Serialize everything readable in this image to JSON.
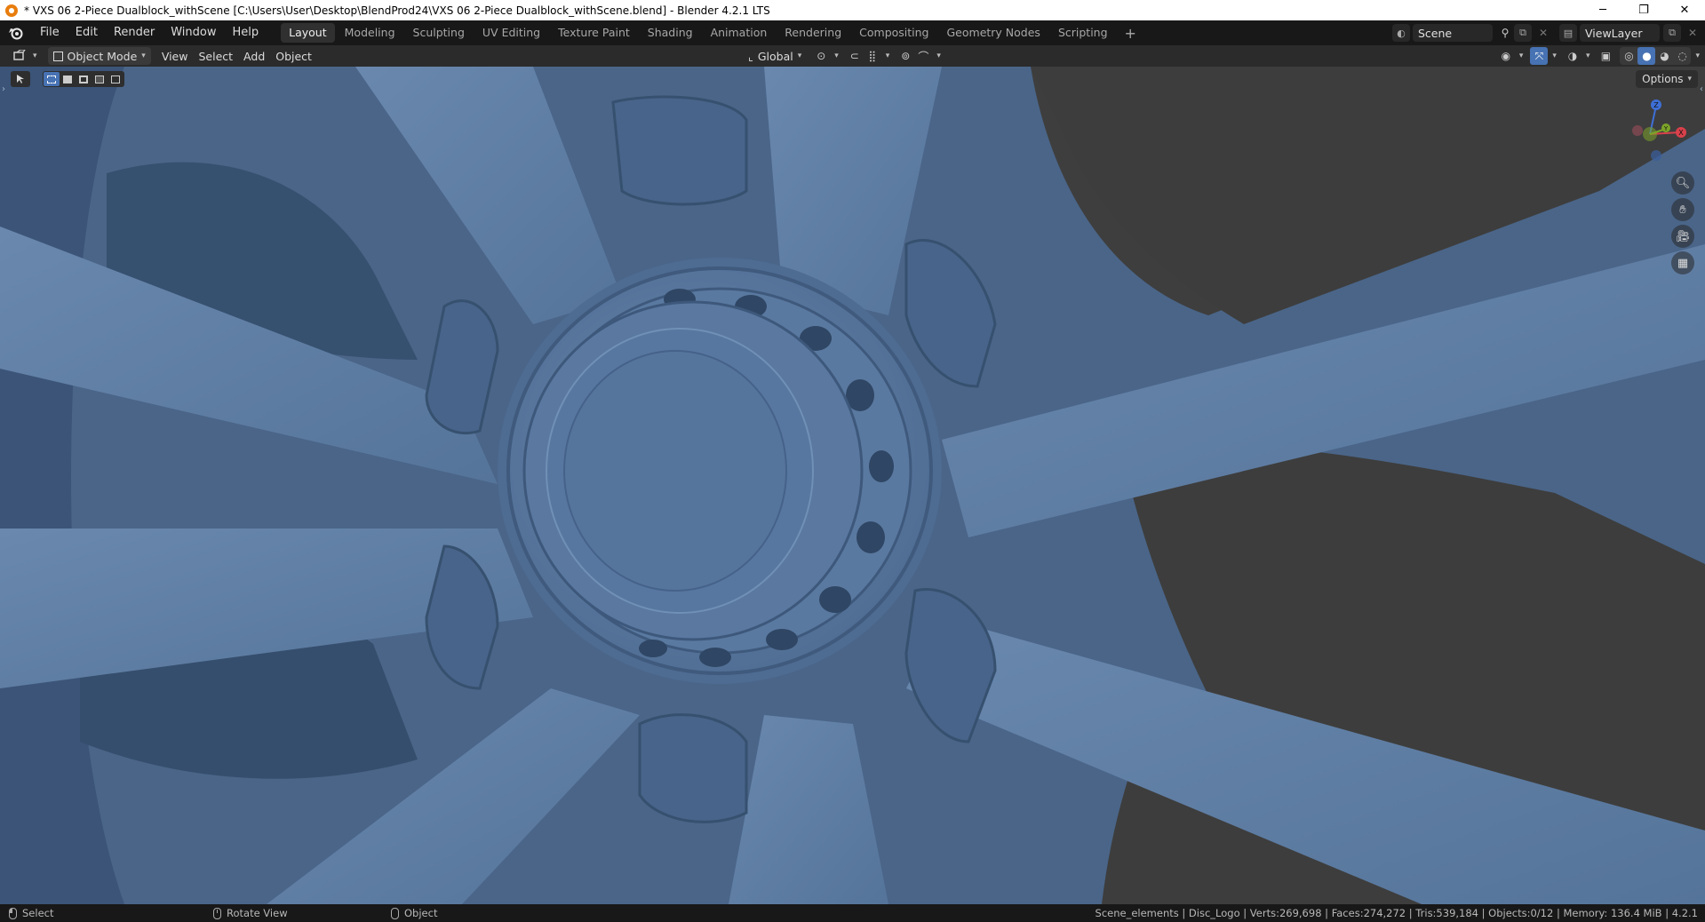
{
  "window": {
    "title": "* VXS 06 2-Piece Dualblock_withScene [C:\\Users\\User\\Desktop\\BlendProd24\\VXS 06 2-Piece Dualblock_withScene.blend] - Blender 4.2.1 LTS",
    "minimize": "─",
    "maximize": "❐",
    "close": "✕"
  },
  "menu": {
    "items": [
      "File",
      "Edit",
      "Render",
      "Window",
      "Help"
    ]
  },
  "workspaces": {
    "tabs": [
      "Layout",
      "Modeling",
      "Sculpting",
      "UV Editing",
      "Texture Paint",
      "Shading",
      "Animation",
      "Rendering",
      "Compositing",
      "Geometry Nodes",
      "Scripting"
    ],
    "active": "Layout",
    "add": "+"
  },
  "scene": {
    "name": "Scene"
  },
  "view_layer": {
    "name": "ViewLayer"
  },
  "viewport_header": {
    "mode": "Object Mode",
    "menus": [
      "View",
      "Select",
      "Add",
      "Object"
    ],
    "orientation": "Global"
  },
  "viewport": {
    "options_label": "Options",
    "gizmo": {
      "z": "Z",
      "y": "Y",
      "x": "X"
    },
    "accent": "#4772b3",
    "material_color": "#5b7aa0"
  },
  "status": {
    "select": "Select",
    "rotate": "Rotate View",
    "object": "Object",
    "stats": "Scene_elements | Disc_Logo | Verts:269,698 | Faces:274,272 | Tris:539,184 | Objects:0/12 | Memory: 136.4 MiB | 4.2.1"
  }
}
